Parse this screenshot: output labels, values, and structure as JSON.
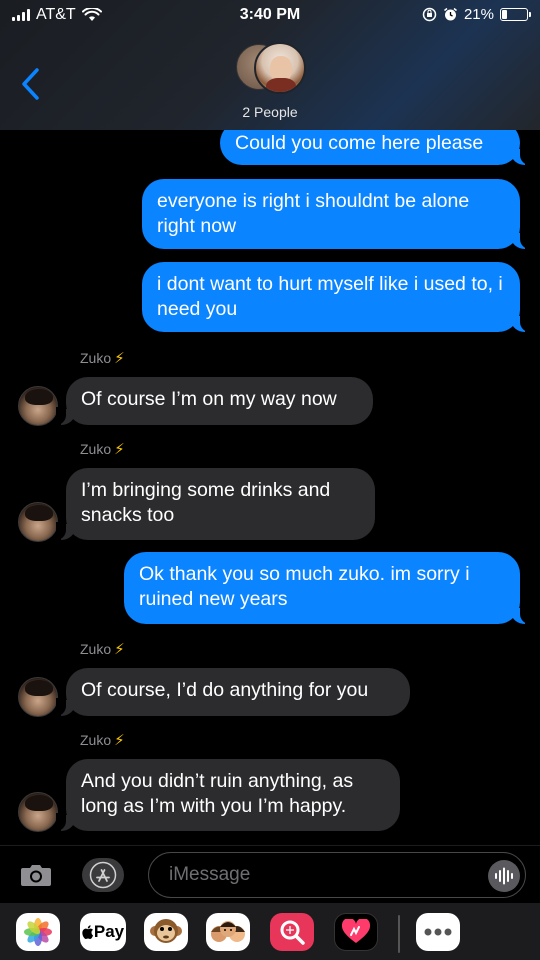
{
  "status_bar": {
    "carrier": "AT&T",
    "time": "3:40 PM",
    "battery_percent": "21%",
    "battery_level": 0.21
  },
  "header": {
    "people_label": "2 People"
  },
  "conversation": {
    "sender_name": "Zuko",
    "messages": [
      {
        "type": "sent",
        "text": "Could you come here please"
      },
      {
        "type": "sent",
        "text": "everyone is right i shouldnt be alone right now"
      },
      {
        "type": "sent",
        "text": "i dont want to hurt myself like i used to, i need you"
      },
      {
        "type": "received",
        "text": "Of course I’m on my way now"
      },
      {
        "type": "received",
        "text": "I’m bringing some drinks and snacks too"
      },
      {
        "type": "sent",
        "text": "Ok thank you so much zuko. im sorry i ruined new years"
      },
      {
        "type": "received",
        "text": "Of course, I’d do anything for you"
      },
      {
        "type": "received",
        "text": "And you didn’t ruin anything, as long as I’m with you I’m happy."
      }
    ]
  },
  "input": {
    "placeholder": "iMessage"
  },
  "app_drawer": {
    "items": [
      "photos-icon",
      "apple-pay-icon",
      "monkey-animoji-icon",
      "memoji-icon",
      "search-images-icon",
      "digital-touch-icon",
      "more-icon"
    ],
    "apple_pay_label": "Pay"
  },
  "colors": {
    "sent_bubble": "#0a84ff",
    "received_bubble": "#2c2c2e",
    "background": "#000000",
    "sender_bolt": "#f5c400"
  }
}
